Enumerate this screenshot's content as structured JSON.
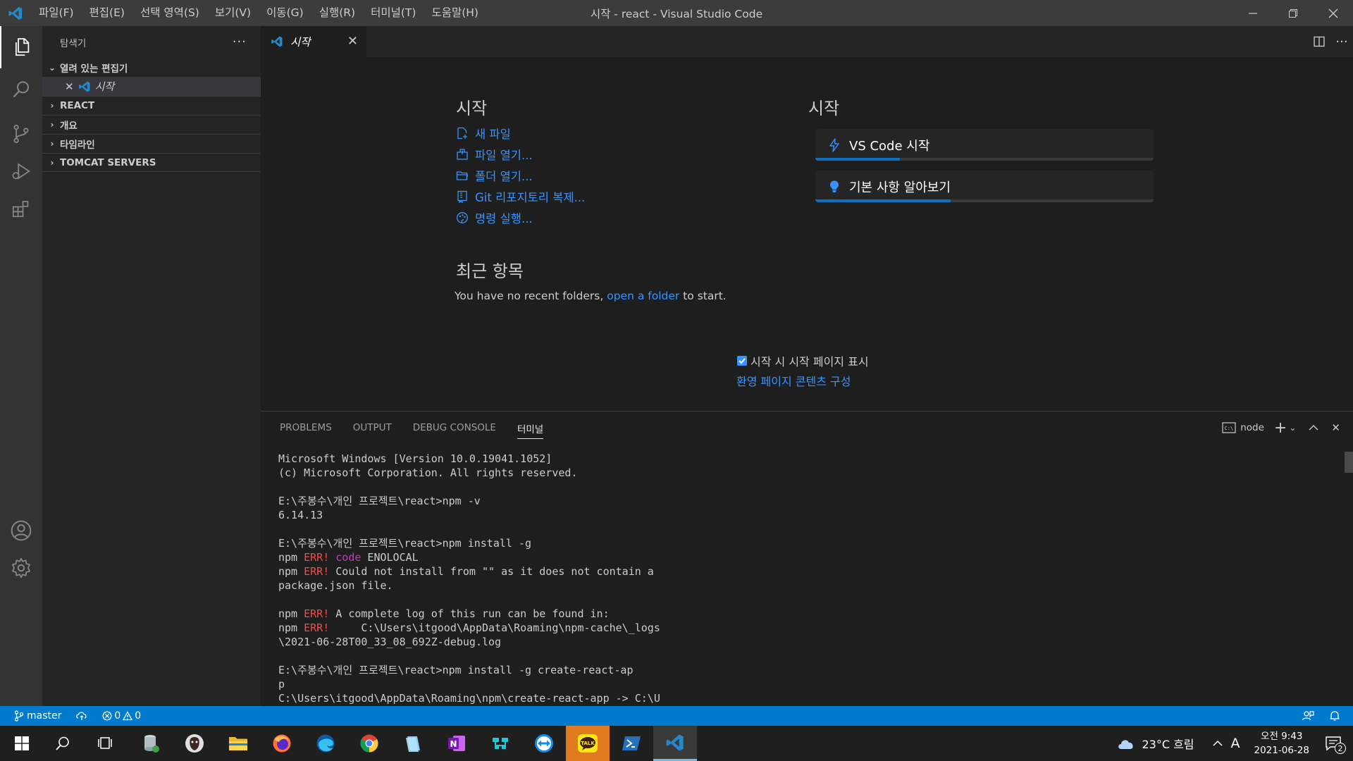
{
  "window": {
    "title": "시작 - react - Visual Studio Code"
  },
  "menu": [
    "파일(F)",
    "편집(E)",
    "선택 영역(S)",
    "보기(V)",
    "이동(G)",
    "실행(R)",
    "터미널(T)",
    "도움말(H)"
  ],
  "sidebar": {
    "title": "탐색기",
    "open_editors_label": "열려 있는 편집기",
    "open_editor_item": "시작",
    "sections": [
      "REACT",
      "개요",
      "타임라인",
      "TOMCAT SERVERS"
    ]
  },
  "tab": {
    "label": "시작"
  },
  "welcome": {
    "start_heading": "시작",
    "links": [
      "새 파일",
      "파일 열기...",
      "폴더 열기...",
      "Git 리포지토리 복제...",
      "명령 실행..."
    ],
    "recent_heading": "최근 항목",
    "recent_text_pre": "You have no recent folders,",
    "recent_link": "open a folder",
    "recent_text_post": "to start.",
    "walk_heading": "시작",
    "walkthroughs": [
      {
        "label": "VS Code 시작",
        "progress": 0.25
      },
      {
        "label": "기본 사항 알아보기",
        "progress": 0.4
      }
    ],
    "show_on_startup": "시작 시 시작 페이지 표시",
    "configure_link": "환영 페이지 콘텐츠 구성"
  },
  "panel": {
    "tabs": [
      "PROBLEMS",
      "OUTPUT",
      "DEBUG CONSOLE",
      "터미널"
    ],
    "terminal_name": "node",
    "terminal_lines": [
      "Microsoft Windows [Version 10.0.19041.1052]",
      "(c) Microsoft Corporation. All rights reserved.",
      "",
      "E:\\주봉수\\개인 프로젝트\\react>npm -v",
      "6.14.13",
      "",
      "E:\\주봉수\\개인 프로젝트\\react>npm install -g",
      "npm ERR! code ENOLOCAL",
      "npm ERR! Could not install from \"\" as it does not contain a",
      "package.json file.",
      "",
      "npm ERR! A complete log of this run can be found in:",
      "npm ERR!     C:\\Users\\itgood\\AppData\\Roaming\\npm-cache\\_logs",
      "\\2021-06-28T00_33_08_692Z-debug.log",
      "",
      "E:\\주봉수\\개인 프로젝트\\react>npm install -g create-react-ap",
      "p",
      "C:\\Users\\itgood\\AppData\\Roaming\\npm\\create-react-app -> C:\\U"
    ]
  },
  "status": {
    "branch": "master",
    "errors": "0",
    "warnings": "0"
  },
  "taskbar": {
    "weather": "23°C 흐림",
    "ime": "A",
    "time": "오전 9:43",
    "date": "2021-06-28",
    "notifications": "2",
    "kakao_label": "TALK"
  }
}
